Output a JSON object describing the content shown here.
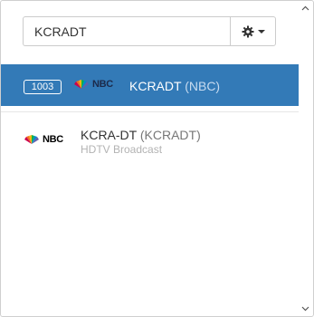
{
  "search": {
    "value": "KCRADT"
  },
  "colors": {
    "selected_row": "#337ab7",
    "accent_text": "#ffffff"
  },
  "results": [
    {
      "channel_number": "1003",
      "logo_text": "NBC",
      "title": "KCRADT",
      "subtitle": "(NBC)",
      "selected": true
    },
    {
      "logo_text": "NBC",
      "title": "KCRA-DT",
      "callsign": "(KCRADT)",
      "description": "HDTV Broadcast",
      "selected": false
    }
  ],
  "icons": {
    "settings": "gear-icon",
    "dropdown": "caret-down-icon",
    "scroll_up": "chevron-up-icon",
    "scroll_down": "chevron-down-icon",
    "network_logo": "nbc-peacock-logo"
  }
}
